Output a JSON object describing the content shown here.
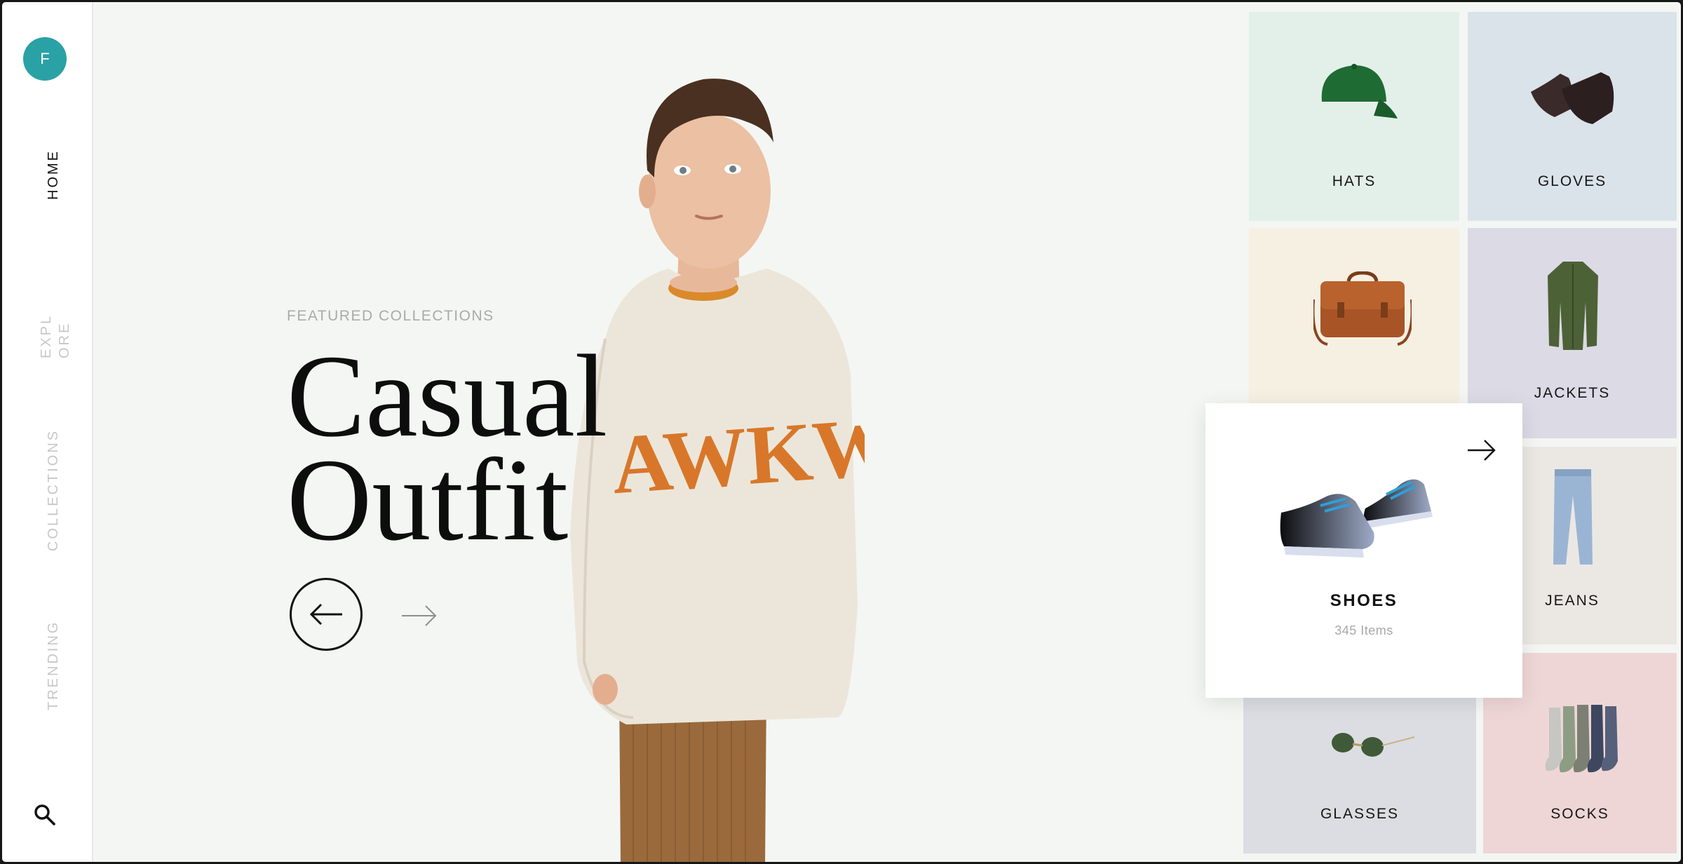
{
  "sidebar": {
    "avatar_initial": "F",
    "nav": [
      "HOME",
      "EXPL ORE",
      "COLLECTIONS",
      "TRENDING"
    ],
    "explore_lines": [
      "EXPL",
      "ORE"
    ]
  },
  "hero": {
    "eyebrow": "FEATURED COLLECTIONS",
    "title_line1": "Casual",
    "title_line2": "Outfit",
    "shirt_text": "AWKWA"
  },
  "categories": {
    "hats": "HATS",
    "gloves": "GLOVES",
    "jackets": "JACKETS",
    "jeans": "JEANS",
    "glasses": "GLASSES",
    "socks": "SOCKS"
  },
  "featured_card": {
    "title": "SHOES",
    "count": "345 Items"
  },
  "colors": {
    "avatar": "#2aa1a5",
    "hats_bg": "#e3f0ea",
    "gloves_bg": "#dbe3ea",
    "bag_bg": "#f6f0e3",
    "jackets_bg": "#dcdae5",
    "jeans_bg": "#ebe8e4",
    "glasses_bg": "#dcdde2",
    "socks_bg": "#eed6d6"
  },
  "icons": [
    "search-icon",
    "arrow-left-icon",
    "arrow-right-icon"
  ]
}
